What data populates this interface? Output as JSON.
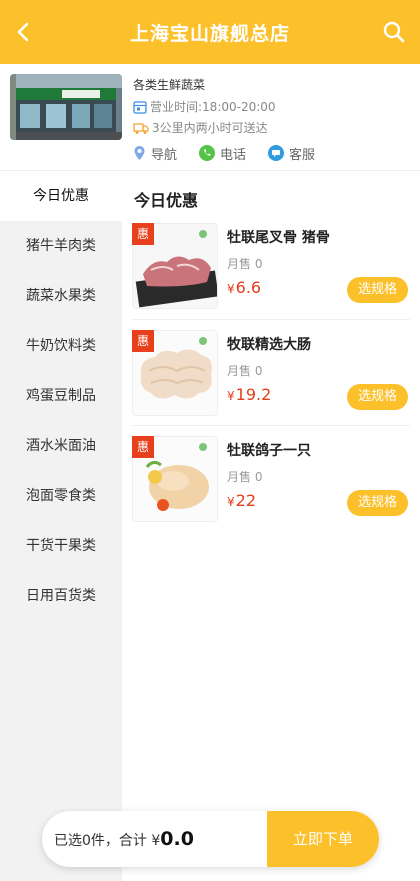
{
  "header": {
    "title": "上海宝山旗舰总店"
  },
  "store": {
    "category": "各类生鲜蔬菜",
    "hours": "营业时间:18:00-20:00",
    "delivery": "3公里内两小时可送达",
    "actions": {
      "navigate": "导航",
      "phone": "电话",
      "service": "客服"
    }
  },
  "sidebar": {
    "items": [
      {
        "label": "今日优惠"
      },
      {
        "label": "猪牛羊肉类"
      },
      {
        "label": "蔬菜水果类"
      },
      {
        "label": "牛奶饮料类"
      },
      {
        "label": "鸡蛋豆制品"
      },
      {
        "label": "酒水米面油"
      },
      {
        "label": "泡面零食类"
      },
      {
        "label": "干货干果类"
      },
      {
        "label": "日用百货类"
      }
    ]
  },
  "main": {
    "section_title": "今日优惠",
    "products": [
      {
        "tag": "惠",
        "name": "牡联尾叉骨 猪骨",
        "sales": "月售 0",
        "currency": "¥",
        "price": "6.6",
        "button": "选规格"
      },
      {
        "tag": "惠",
        "name": "牧联精选大肠",
        "sales": "月售 0",
        "currency": "¥",
        "price": "19.2",
        "button": "选规格"
      },
      {
        "tag": "惠",
        "name": "牡联鸽子一只",
        "sales": "月售 0",
        "currency": "¥",
        "price": "22",
        "button": "选规格"
      }
    ]
  },
  "cart": {
    "summary": "已选0件，合计 ¥",
    "total": "0.0",
    "order_button": "立即下单"
  },
  "colors": {
    "accent": "#fcc02b",
    "price": "#e23d1b",
    "tag": "#e8401c"
  }
}
